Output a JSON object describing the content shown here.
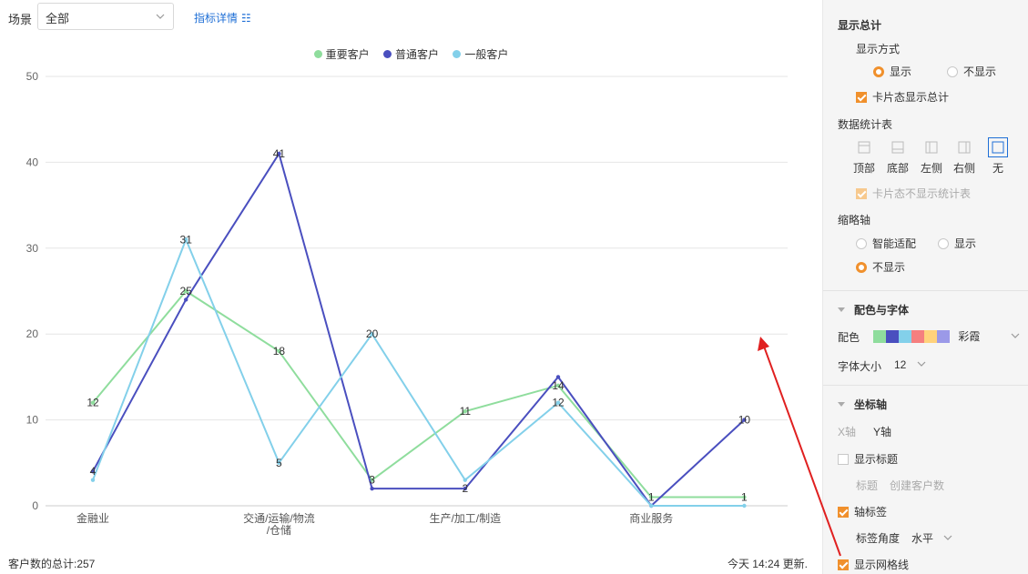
{
  "toolbar": {
    "scene_label": "场景",
    "scene_value": "全部",
    "detail_link": "指标详情"
  },
  "legend": [
    {
      "name": "重要客户",
      "color": "#8fdd9d"
    },
    {
      "name": "普通客户",
      "color": "#4a4fbf"
    },
    {
      "name": "一般客户",
      "color": "#83d0ea"
    }
  ],
  "chart_data": {
    "type": "line",
    "x": [
      "金融业",
      "",
      "交通/运输/物流/仓储",
      "",
      "生产/加工/制造",
      "",
      "商业服务",
      ""
    ],
    "x_tick_labels": [
      "金融业",
      "交通/运输/物流\n/仓储",
      "生产/加工/制造",
      "商业服务"
    ],
    "ylim": [
      0,
      50
    ],
    "yticks": [
      0,
      10,
      20,
      30,
      40,
      50
    ],
    "grid": true,
    "legend_position": "top-center",
    "series": [
      {
        "name": "重要客户",
        "color": "#8fdd9d",
        "values": [
          12,
          25,
          18,
          3,
          11,
          14,
          1,
          1
        ]
      },
      {
        "name": "普通客户",
        "color": "#4a4fbf",
        "values": [
          4,
          24,
          41,
          2,
          2,
          15,
          0,
          10
        ]
      },
      {
        "name": "一般客户",
        "color": "#83d0ea",
        "values": [
          3,
          31,
          5,
          20,
          3,
          12,
          0,
          0
        ]
      }
    ],
    "data_labels": [
      {
        "x": 0,
        "text": "12",
        "value": 12
      },
      {
        "x": 0,
        "text": "4",
        "value": 4
      },
      {
        "x": 1,
        "text": "31",
        "value": 31
      },
      {
        "x": 1,
        "text": "25",
        "value": 25
      },
      {
        "x": 2,
        "text": "41",
        "value": 41
      },
      {
        "x": 2,
        "text": "18",
        "value": 18
      },
      {
        "x": 2,
        "text": "5",
        "value": 5
      },
      {
        "x": 3,
        "text": "20",
        "value": 20
      },
      {
        "x": 3,
        "text": "3",
        "value": 3
      },
      {
        "x": 4,
        "text": "11",
        "value": 11
      },
      {
        "x": 4,
        "text": "2",
        "value": 2
      },
      {
        "x": 5,
        "text": "14",
        "value": 14
      },
      {
        "x": 5,
        "text": "12",
        "value": 12
      },
      {
        "x": 6,
        "text": "1",
        "value": 1
      },
      {
        "x": 7,
        "text": "10",
        "value": 10
      },
      {
        "x": 7,
        "text": "1",
        "value": 1
      }
    ]
  },
  "footer": {
    "total": "客户数的总计:257",
    "update": "今天 14:24 更新."
  },
  "panel": {
    "show_total": "显示总计",
    "display_mode": "显示方式",
    "show": "显示",
    "not_show": "不显示",
    "card_show_total": "卡片态显示总计",
    "data_table": "数据统计表",
    "positions": [
      "顶部",
      "底部",
      "左侧",
      "右侧",
      "无"
    ],
    "card_hide_table": "卡片态不显示统计表",
    "thumbnail_axis": "缩略轴",
    "smart_fit": "智能适配",
    "thumb_show": "显示",
    "thumb_hide": "不显示",
    "color_font": "配色与字体",
    "color_label": "配色",
    "palette": [
      "#8fdd9d",
      "#4a4fbf",
      "#83d0ea",
      "#f57f7f",
      "#ffd27c",
      "#9b99e8"
    ],
    "palette_name": "彩霞",
    "font_size_label": "字体大小",
    "font_size_value": "12",
    "axis_section": "坐标轴",
    "x_axis": "X轴",
    "y_axis": "Y轴",
    "show_title": "显示标题",
    "title_label": "标题",
    "title_placeholder": "创建客户数",
    "axis_labels": "轴标签",
    "label_angle": "标签角度",
    "label_angle_value": "水平",
    "show_grid": "显示网格线"
  }
}
